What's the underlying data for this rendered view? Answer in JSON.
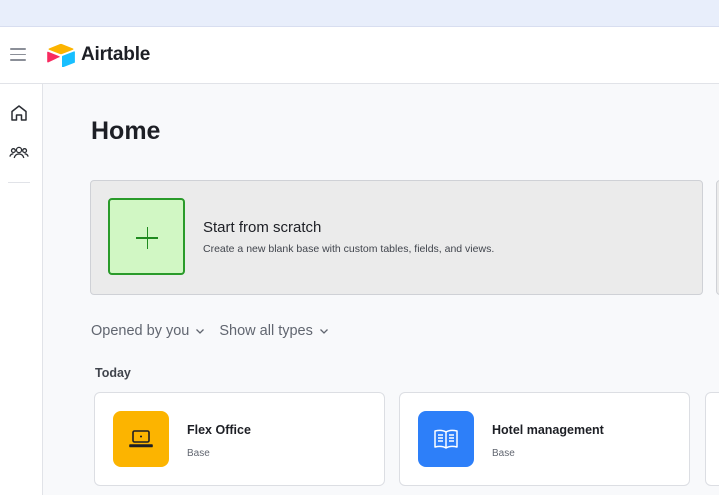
{
  "app": {
    "name": "Airtable"
  },
  "sidebar": {
    "items": [
      {
        "icon": "home-icon"
      },
      {
        "icon": "people-icon"
      }
    ]
  },
  "main": {
    "title": "Home",
    "scratch": {
      "title": "Start from scratch",
      "description": "Create a new blank base with custom tables, fields, and views."
    },
    "filters": {
      "owner": "Opened by you",
      "types": "Show all types"
    },
    "section_label": "Today",
    "bases": [
      {
        "name": "Flex Office",
        "type": "Base",
        "icon": "laptop-icon",
        "color": "#fcb400"
      },
      {
        "name": "Hotel management",
        "type": "Base",
        "icon": "book-icon",
        "color": "#2d7ff9"
      }
    ]
  },
  "colors": {
    "topstrip": "#e8eefb",
    "scratch_bg": "#ebebeb",
    "scratch_plus_bg": "#d1f7c4",
    "scratch_plus_border": "#2a9b2a"
  }
}
